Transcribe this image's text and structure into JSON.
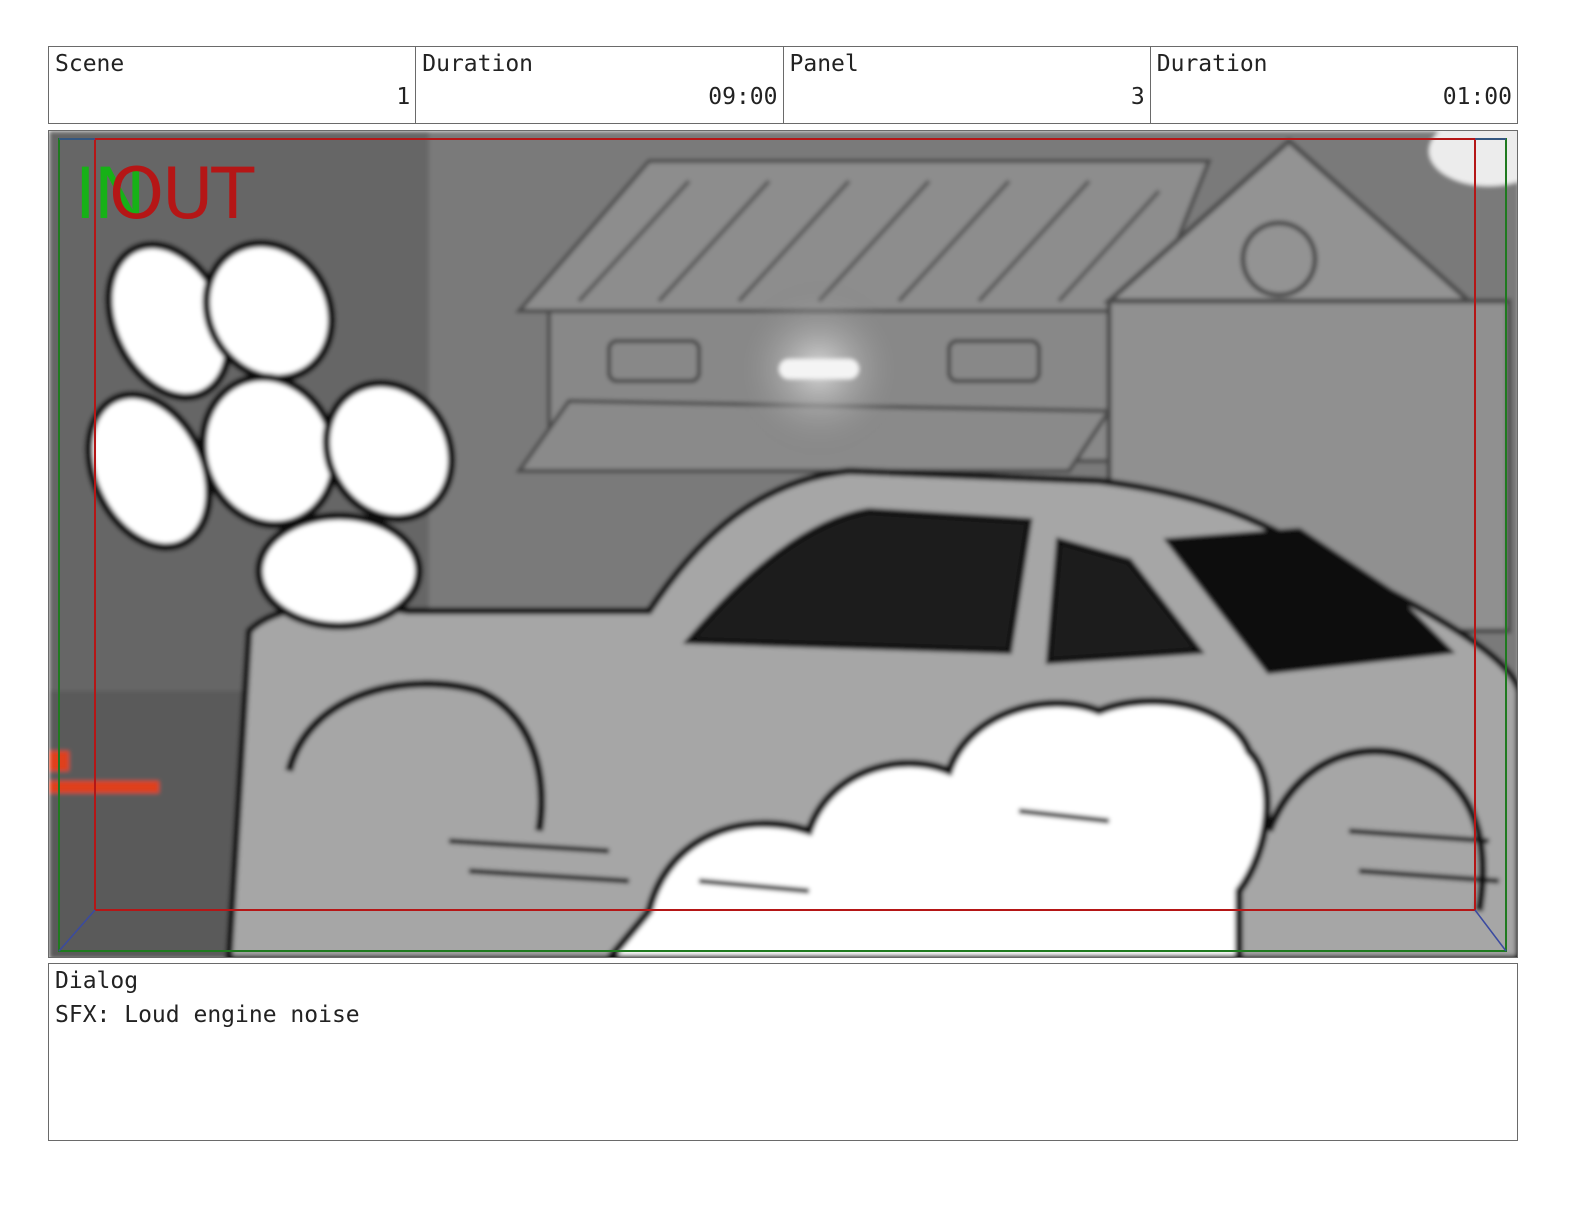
{
  "header": {
    "scene_label": "Scene",
    "scene_value": "1",
    "scene_duration_label": "Duration",
    "scene_duration_value": "09:00",
    "panel_label": "Panel",
    "panel_value": "3",
    "panel_duration_label": "Duration",
    "panel_duration_value": "01:00"
  },
  "frame": {
    "in_marker": "IN",
    "out_marker": "OUT",
    "safe_area_color": "#b51616",
    "camera_frame_color": "#1f7a1f"
  },
  "dialog": {
    "label": "Dialog",
    "text": "SFX: Loud engine noise"
  }
}
